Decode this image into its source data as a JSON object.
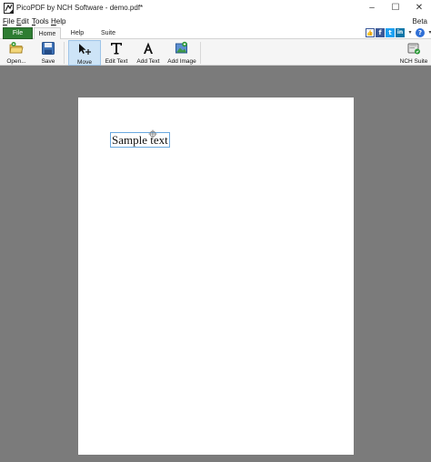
{
  "window": {
    "title": "PicoPDF by NCH Software - demo.pdf*",
    "minimize": "–",
    "maximize": "☐",
    "close": "✕"
  },
  "menu": {
    "items": [
      {
        "label_ul": "F",
        "label_rest": "ile"
      },
      {
        "label_ul": "E",
        "label_rest": "dit"
      },
      {
        "label_ul": "T",
        "label_rest": "ools"
      },
      {
        "label_ul": "H",
        "label_rest": "elp"
      }
    ],
    "beta": "Beta"
  },
  "tabs": {
    "file": "File",
    "home": "Home",
    "help": "Help",
    "suite": "Suite"
  },
  "social": {
    "like": "👍",
    "facebook": "f",
    "twitter": "t",
    "linkedin": "in",
    "nav": "▾",
    "help": "?"
  },
  "ribbon": {
    "open": "Open...",
    "save": "Save",
    "move": "Move",
    "edit_text": "Edit Text",
    "add_text": "Add Text",
    "add_image": "Add Image",
    "nch_suite": "NCH Suite"
  },
  "document": {
    "text_box": "Sample text"
  },
  "colors": {
    "file_tab": "#2e7d32",
    "workspace": "#7b7b7b",
    "active_tool": "#cde4f7",
    "selection_border": "#6aa9e0"
  }
}
